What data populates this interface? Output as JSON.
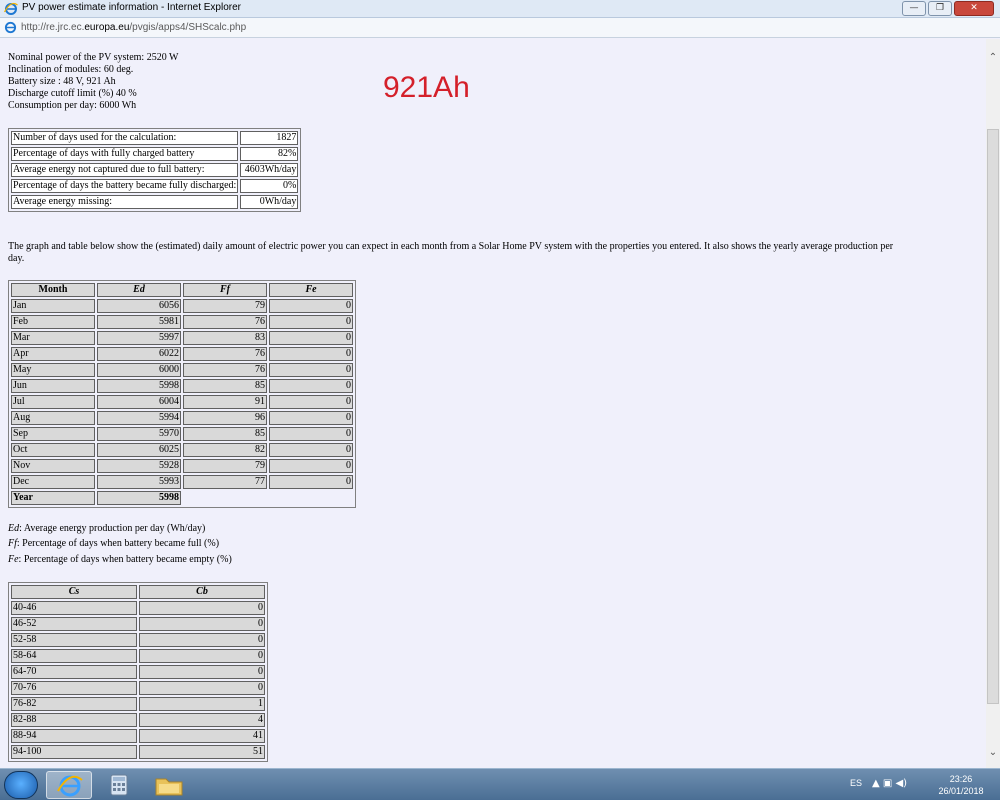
{
  "window": {
    "title": "PV power estimate information - Internet Explorer",
    "minimize": "—",
    "maximize": "❐",
    "close": "✕"
  },
  "address": {
    "prefix": "http://re.jrc.ec.",
    "domain": "europa.eu",
    "path": "/pvgis/apps4/SHScalc.php"
  },
  "params": [
    "Nominal power of the PV system: 2520 W",
    "Inclination of modules: 60 deg.",
    "Battery size : 48 V, 921 Ah",
    "Discharge cutoff limit (%) 40 %",
    "Consumption per day: 6000 Wh"
  ],
  "annotation": "921Ah",
  "summary": [
    {
      "label": "Number of days used for the calculation:",
      "value": "1827"
    },
    {
      "label": "Percentage of days with fully charged battery",
      "value": "82%"
    },
    {
      "label": "Average energy not captured due to full battery:",
      "value": "4603Wh/day"
    },
    {
      "label": "Percentage of days the battery became fully discharged:",
      "value": "0%"
    },
    {
      "label": "Average energy missing:",
      "value": "0Wh/day"
    }
  ],
  "description": "The graph and table below show the (estimated) daily amount of electric power you can expect in each month from a Solar Home PV system with the properties you entered. It also shows the yearly average production per day.",
  "monthly": {
    "headers": [
      "Month",
      "Ed",
      "Ff",
      "Fe"
    ],
    "rows": [
      [
        "Jan",
        "6056",
        "79",
        "0"
      ],
      [
        "Feb",
        "5981",
        "76",
        "0"
      ],
      [
        "Mar",
        "5997",
        "83",
        "0"
      ],
      [
        "Apr",
        "6022",
        "76",
        "0"
      ],
      [
        "May",
        "6000",
        "76",
        "0"
      ],
      [
        "Jun",
        "5998",
        "85",
        "0"
      ],
      [
        "Jul",
        "6004",
        "91",
        "0"
      ],
      [
        "Aug",
        "5994",
        "96",
        "0"
      ],
      [
        "Sep",
        "5970",
        "85",
        "0"
      ],
      [
        "Oct",
        "6025",
        "82",
        "0"
      ],
      [
        "Nov",
        "5928",
        "79",
        "0"
      ],
      [
        "Dec",
        "5993",
        "77",
        "0"
      ]
    ],
    "year_label": "Year",
    "year_value": "5998"
  },
  "legend": [
    {
      "sym": "Ed",
      "text": ": Average energy production per day (Wh/day)"
    },
    {
      "sym": "Ff",
      "text": ": Percentage of days when battery became full (%)"
    },
    {
      "sym": "Fe",
      "text": ": Percentage of days when battery became empty (%)"
    }
  ],
  "capacity": {
    "headers": [
      "Cs",
      "Cb"
    ],
    "rows": [
      [
        "40-46",
        "0"
      ],
      [
        "46-52",
        "0"
      ],
      [
        "52-58",
        "0"
      ],
      [
        "58-64",
        "0"
      ],
      [
        "64-70",
        "0"
      ],
      [
        "70-76",
        "0"
      ],
      [
        "76-82",
        "1"
      ],
      [
        "82-88",
        "4"
      ],
      [
        "88-94",
        "41"
      ],
      [
        "94-100",
        "51"
      ]
    ]
  },
  "taskbar": {
    "lang": "ES",
    "tray_icons": "▲ ▣ ◀)",
    "time": "23:26",
    "date": "26/01/2018"
  },
  "colors": {
    "annotation": "#d4202a",
    "page_background": "#f0f0fb",
    "cell_gray": "#d9d9d9"
  }
}
